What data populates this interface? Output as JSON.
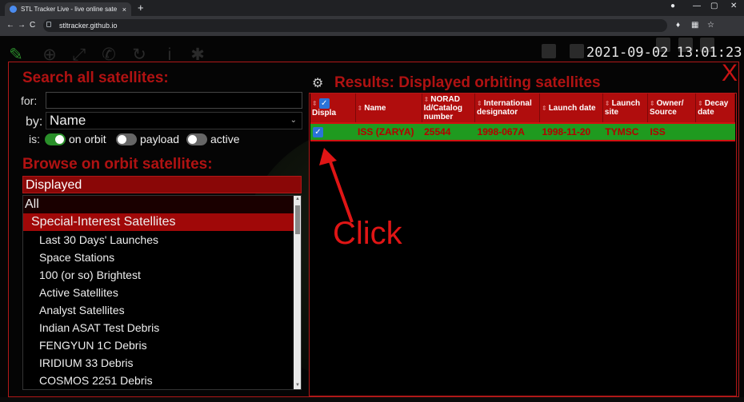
{
  "browser": {
    "tab_title": "STL Tracker Live - live online sate",
    "tab_close": "×",
    "new_tab": "+",
    "url": "stltracker.github.io"
  },
  "app": {
    "clock": "2021-09-02 13:01:23",
    "close": "X",
    "search": {
      "heading": "Search all satellites:",
      "for_label": "for:",
      "for_value": "",
      "by_label": "by:",
      "by_value": "Name",
      "is_label": "is:",
      "toggles": [
        {
          "label": "on orbit",
          "on": true
        },
        {
          "label": "payload",
          "on": false
        },
        {
          "label": "active",
          "on": false
        }
      ]
    },
    "browse": {
      "heading": "Browse on orbit satellites:",
      "displayed_label": "Displayed",
      "items": [
        {
          "label": "All",
          "type": "all"
        },
        {
          "label": "Special-Interest Satellites",
          "type": "special"
        },
        {
          "label": "Last 30 Days' Launches",
          "type": "child"
        },
        {
          "label": "Space Stations",
          "type": "child"
        },
        {
          "label": "100 (or so) Brightest",
          "type": "child"
        },
        {
          "label": "Active Satellites",
          "type": "child"
        },
        {
          "label": "Analyst Satellites",
          "type": "child"
        },
        {
          "label": "Indian ASAT Test Debris",
          "type": "child"
        },
        {
          "label": "FENGYUN 1C Debris",
          "type": "child"
        },
        {
          "label": "IRIDIUM 33 Debris",
          "type": "child"
        },
        {
          "label": "COSMOS 2251 Debris",
          "type": "child"
        }
      ]
    },
    "results": {
      "heading": "Results: Displayed orbiting satellites",
      "columns": [
        "Displa",
        "Name",
        "NORAD Id/Catalog number",
        "International designator",
        "Launch date",
        "Launch site",
        "Owner/ Source",
        "Decay date"
      ],
      "rows": [
        {
          "displayed": true,
          "name": "ISS (ZARYA)",
          "norad": "25544",
          "intl": "1998-067A",
          "launch_date": "1998-11-20",
          "site": "TYMSC",
          "owner": "ISS",
          "decay": ""
        }
      ]
    },
    "annotation": "Click"
  }
}
